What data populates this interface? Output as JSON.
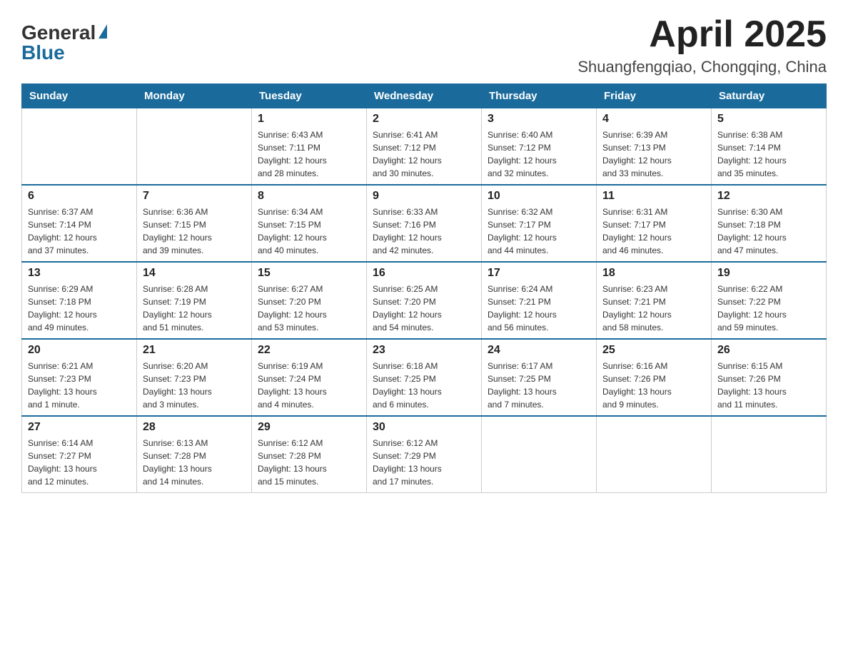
{
  "header": {
    "logo_general": "General",
    "logo_blue": "Blue",
    "month": "April 2025",
    "location": "Shuangfengqiao, Chongqing, China"
  },
  "weekdays": [
    "Sunday",
    "Monday",
    "Tuesday",
    "Wednesday",
    "Thursday",
    "Friday",
    "Saturday"
  ],
  "weeks": [
    [
      {
        "day": "",
        "info": ""
      },
      {
        "day": "",
        "info": ""
      },
      {
        "day": "1",
        "info": "Sunrise: 6:43 AM\nSunset: 7:11 PM\nDaylight: 12 hours\nand 28 minutes."
      },
      {
        "day": "2",
        "info": "Sunrise: 6:41 AM\nSunset: 7:12 PM\nDaylight: 12 hours\nand 30 minutes."
      },
      {
        "day": "3",
        "info": "Sunrise: 6:40 AM\nSunset: 7:12 PM\nDaylight: 12 hours\nand 32 minutes."
      },
      {
        "day": "4",
        "info": "Sunrise: 6:39 AM\nSunset: 7:13 PM\nDaylight: 12 hours\nand 33 minutes."
      },
      {
        "day": "5",
        "info": "Sunrise: 6:38 AM\nSunset: 7:14 PM\nDaylight: 12 hours\nand 35 minutes."
      }
    ],
    [
      {
        "day": "6",
        "info": "Sunrise: 6:37 AM\nSunset: 7:14 PM\nDaylight: 12 hours\nand 37 minutes."
      },
      {
        "day": "7",
        "info": "Sunrise: 6:36 AM\nSunset: 7:15 PM\nDaylight: 12 hours\nand 39 minutes."
      },
      {
        "day": "8",
        "info": "Sunrise: 6:34 AM\nSunset: 7:15 PM\nDaylight: 12 hours\nand 40 minutes."
      },
      {
        "day": "9",
        "info": "Sunrise: 6:33 AM\nSunset: 7:16 PM\nDaylight: 12 hours\nand 42 minutes."
      },
      {
        "day": "10",
        "info": "Sunrise: 6:32 AM\nSunset: 7:17 PM\nDaylight: 12 hours\nand 44 minutes."
      },
      {
        "day": "11",
        "info": "Sunrise: 6:31 AM\nSunset: 7:17 PM\nDaylight: 12 hours\nand 46 minutes."
      },
      {
        "day": "12",
        "info": "Sunrise: 6:30 AM\nSunset: 7:18 PM\nDaylight: 12 hours\nand 47 minutes."
      }
    ],
    [
      {
        "day": "13",
        "info": "Sunrise: 6:29 AM\nSunset: 7:18 PM\nDaylight: 12 hours\nand 49 minutes."
      },
      {
        "day": "14",
        "info": "Sunrise: 6:28 AM\nSunset: 7:19 PM\nDaylight: 12 hours\nand 51 minutes."
      },
      {
        "day": "15",
        "info": "Sunrise: 6:27 AM\nSunset: 7:20 PM\nDaylight: 12 hours\nand 53 minutes."
      },
      {
        "day": "16",
        "info": "Sunrise: 6:25 AM\nSunset: 7:20 PM\nDaylight: 12 hours\nand 54 minutes."
      },
      {
        "day": "17",
        "info": "Sunrise: 6:24 AM\nSunset: 7:21 PM\nDaylight: 12 hours\nand 56 minutes."
      },
      {
        "day": "18",
        "info": "Sunrise: 6:23 AM\nSunset: 7:21 PM\nDaylight: 12 hours\nand 58 minutes."
      },
      {
        "day": "19",
        "info": "Sunrise: 6:22 AM\nSunset: 7:22 PM\nDaylight: 12 hours\nand 59 minutes."
      }
    ],
    [
      {
        "day": "20",
        "info": "Sunrise: 6:21 AM\nSunset: 7:23 PM\nDaylight: 13 hours\nand 1 minute."
      },
      {
        "day": "21",
        "info": "Sunrise: 6:20 AM\nSunset: 7:23 PM\nDaylight: 13 hours\nand 3 minutes."
      },
      {
        "day": "22",
        "info": "Sunrise: 6:19 AM\nSunset: 7:24 PM\nDaylight: 13 hours\nand 4 minutes."
      },
      {
        "day": "23",
        "info": "Sunrise: 6:18 AM\nSunset: 7:25 PM\nDaylight: 13 hours\nand 6 minutes."
      },
      {
        "day": "24",
        "info": "Sunrise: 6:17 AM\nSunset: 7:25 PM\nDaylight: 13 hours\nand 7 minutes."
      },
      {
        "day": "25",
        "info": "Sunrise: 6:16 AM\nSunset: 7:26 PM\nDaylight: 13 hours\nand 9 minutes."
      },
      {
        "day": "26",
        "info": "Sunrise: 6:15 AM\nSunset: 7:26 PM\nDaylight: 13 hours\nand 11 minutes."
      }
    ],
    [
      {
        "day": "27",
        "info": "Sunrise: 6:14 AM\nSunset: 7:27 PM\nDaylight: 13 hours\nand 12 minutes."
      },
      {
        "day": "28",
        "info": "Sunrise: 6:13 AM\nSunset: 7:28 PM\nDaylight: 13 hours\nand 14 minutes."
      },
      {
        "day": "29",
        "info": "Sunrise: 6:12 AM\nSunset: 7:28 PM\nDaylight: 13 hours\nand 15 minutes."
      },
      {
        "day": "30",
        "info": "Sunrise: 6:12 AM\nSunset: 7:29 PM\nDaylight: 13 hours\nand 17 minutes."
      },
      {
        "day": "",
        "info": ""
      },
      {
        "day": "",
        "info": ""
      },
      {
        "day": "",
        "info": ""
      }
    ]
  ]
}
